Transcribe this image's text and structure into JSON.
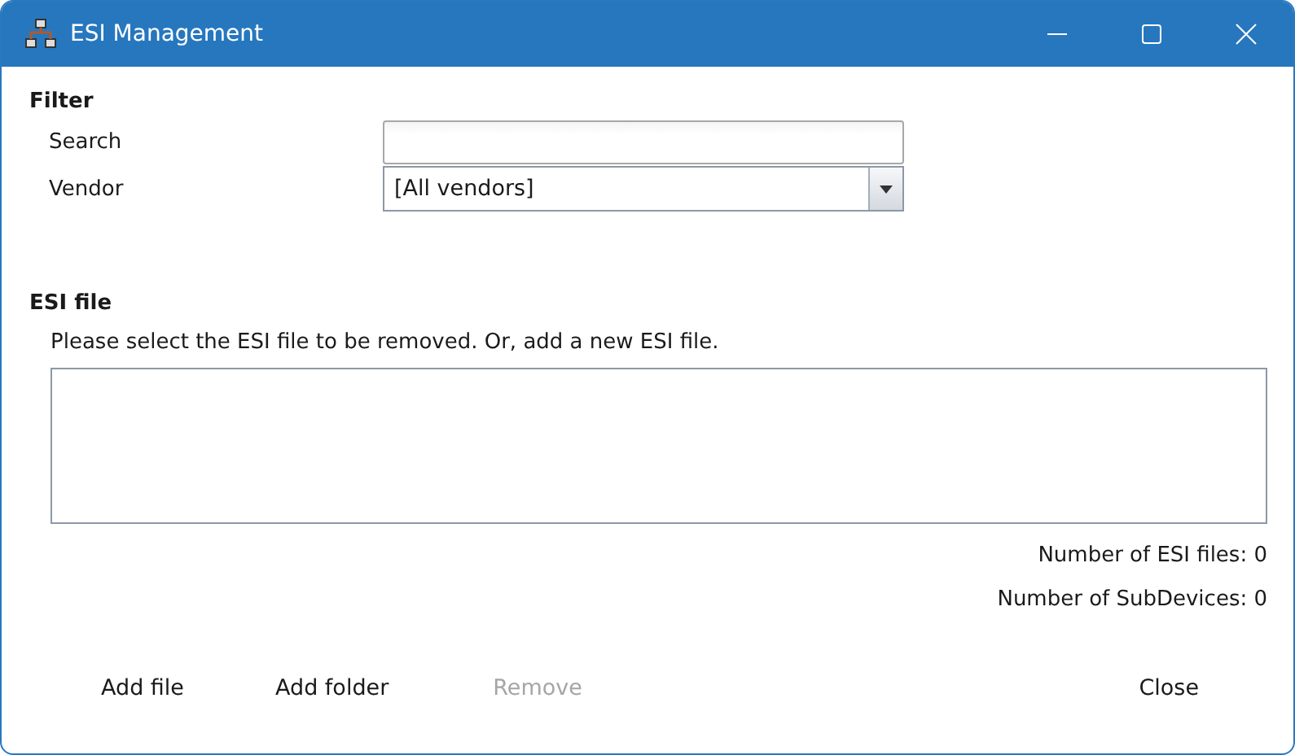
{
  "window": {
    "title": "ESI Management"
  },
  "filter": {
    "heading": "Filter",
    "search": {
      "label": "Search"
    },
    "vendor": {
      "label": "Vendor",
      "value": "[All vendors]"
    }
  },
  "esi_file": {
    "heading": "ESI file",
    "instruction": "Please select the ESI file to be removed. Or, add a new ESI file.",
    "counts": [
      "Number of ESI files: 0",
      "Number of SubDevices: 0"
    ]
  },
  "buttons": [
    {
      "label": "Add file",
      "disabled": false
    },
    {
      "label": "Add folder",
      "disabled": false
    },
    {
      "label": "Remove",
      "disabled": true
    },
    {
      "label": "Close",
      "disabled": false
    }
  ]
}
